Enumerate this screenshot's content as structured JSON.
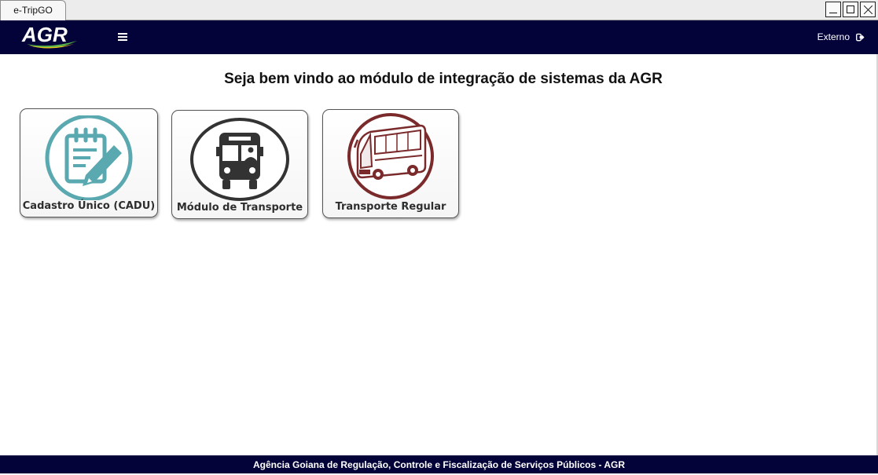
{
  "window": {
    "tab_title": "e-TripGO"
  },
  "header": {
    "logo_text": "AGR",
    "user_label": "Externo"
  },
  "main": {
    "title": "Seja bem vindo ao módulo de integração de sistemas da AGR",
    "tiles": [
      {
        "label": "Cadastro Único (CADU)",
        "icon": "clipboard-pencil-icon",
        "color": "#5aa8b0"
      },
      {
        "label": "Módulo de Transporte",
        "icon": "bus-front-icon",
        "color": "#333333"
      },
      {
        "label": "Transporte Regular",
        "icon": "bus-side-icon",
        "color": "#7a2a2a"
      }
    ]
  },
  "footer": {
    "text": "Agência Goiana de Regulação, Controle e Fiscalização de Serviços Públicos - AGR"
  },
  "colors": {
    "header_bg": "#03033a",
    "footer_bg": "#03033a"
  }
}
